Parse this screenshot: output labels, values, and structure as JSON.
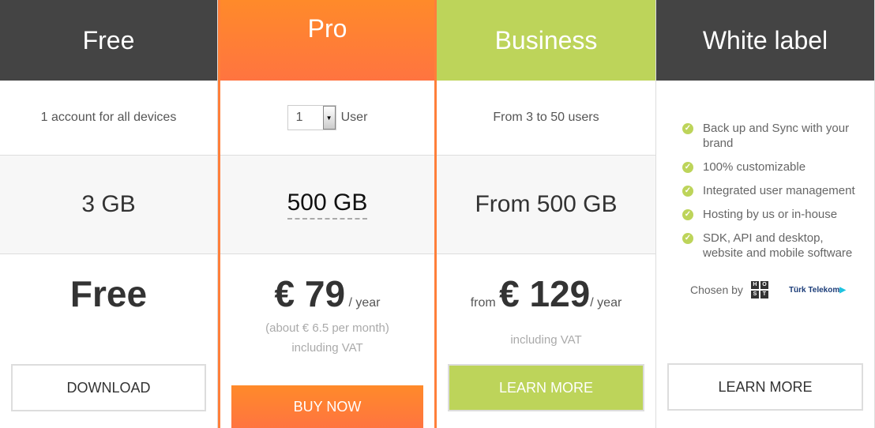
{
  "colors": {
    "dark": "#444444",
    "orange": "#ff7f3a",
    "green": "#bdd45a"
  },
  "plans": [
    {
      "name": "Free",
      "desc": "1 account for all devices",
      "storage": "3 GB",
      "price": "Free",
      "button": "DOWNLOAD"
    },
    {
      "name": "Pro",
      "users_value": "1",
      "users_label": "User",
      "storage": "500 GB",
      "currency_price": "€ 79",
      "period": "/ year",
      "note1": "(about € 6.5 per month)",
      "note2": "including VAT",
      "button": "BUY NOW"
    },
    {
      "name": "Business",
      "desc": "From 3 to 50 users",
      "storage": "From 500 GB",
      "from": "from",
      "currency_price": "€ 129",
      "period": "/ year",
      "note": "including VAT",
      "button": "LEARN MORE"
    },
    {
      "name": "White label",
      "features": [
        "Back up and Sync with your brand",
        "100% customizable",
        "Integrated user management",
        "Hosting by us or in-house",
        "SDK, API and desktop, website and mobile software"
      ],
      "chosen_by": "Chosen by",
      "logos": [
        "HOST",
        "Türk Telekom"
      ],
      "button": "LEARN MORE"
    }
  ]
}
